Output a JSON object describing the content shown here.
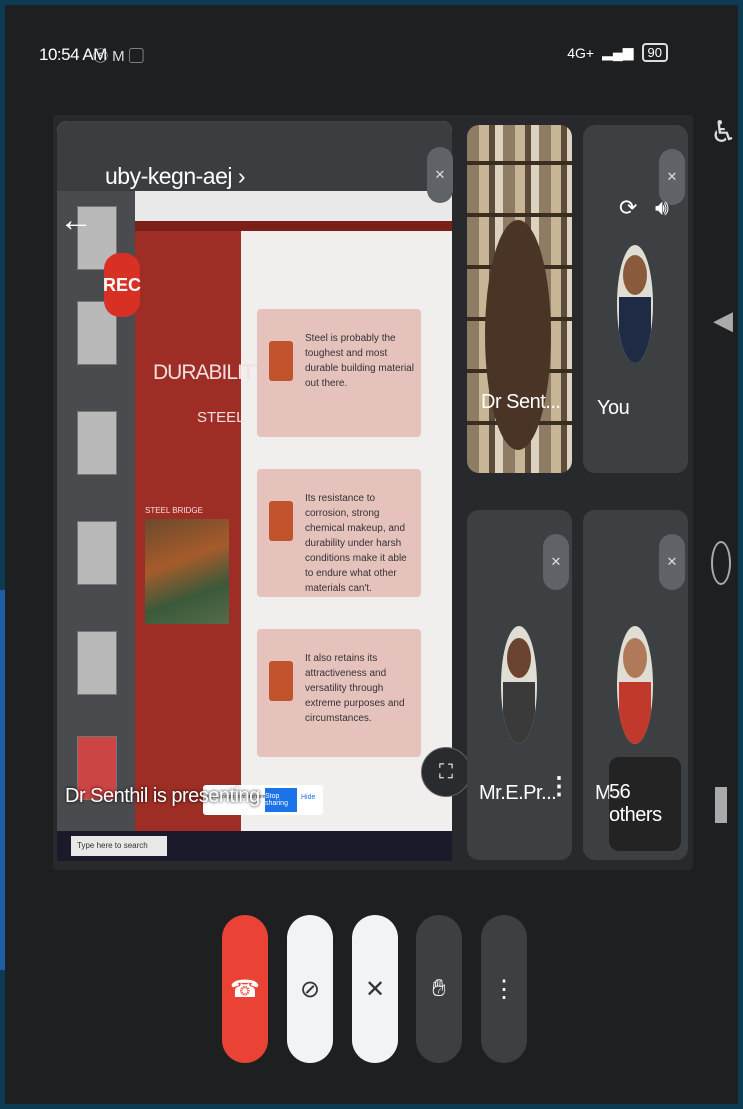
{
  "status_bar": {
    "time": "10:54 AM",
    "icons": "ⓢ M ▢",
    "signal": "4G+",
    "battery": "90"
  },
  "meeting": {
    "code": "uby-kegn-aej",
    "recording_label": "REC",
    "presenting_text": "Dr Senthil is presenting"
  },
  "slide": {
    "title": "DURABILITY",
    "subtitle": "STEEL",
    "image_caption": "STEEL BRIDGE",
    "points": [
      "Steel is probably the toughest and most durable building material out there.",
      "Its resistance to corrosion, strong chemical makeup, and durability under harsh conditions make it able to endure what other materials can't.",
      "It also retains its attractiveness and versatility through extreme purposes and circumstances."
    ]
  },
  "share_banner": {
    "text": "meet.google.com is sharing your screen.",
    "stop_label": "Stop sharing",
    "hide_label": "Hide"
  },
  "taskbar": {
    "search_placeholder": "Type here to search"
  },
  "participants": [
    {
      "name": "Dr Sent..."
    },
    {
      "name": "You"
    },
    {
      "name": "Mr.E.Pr..."
    },
    {
      "name": "Mu"
    }
  ],
  "others_label": "56 others",
  "colors": {
    "end_call": "#ea4335",
    "rec": "#d93025",
    "slide_red": "#9e2e25"
  }
}
